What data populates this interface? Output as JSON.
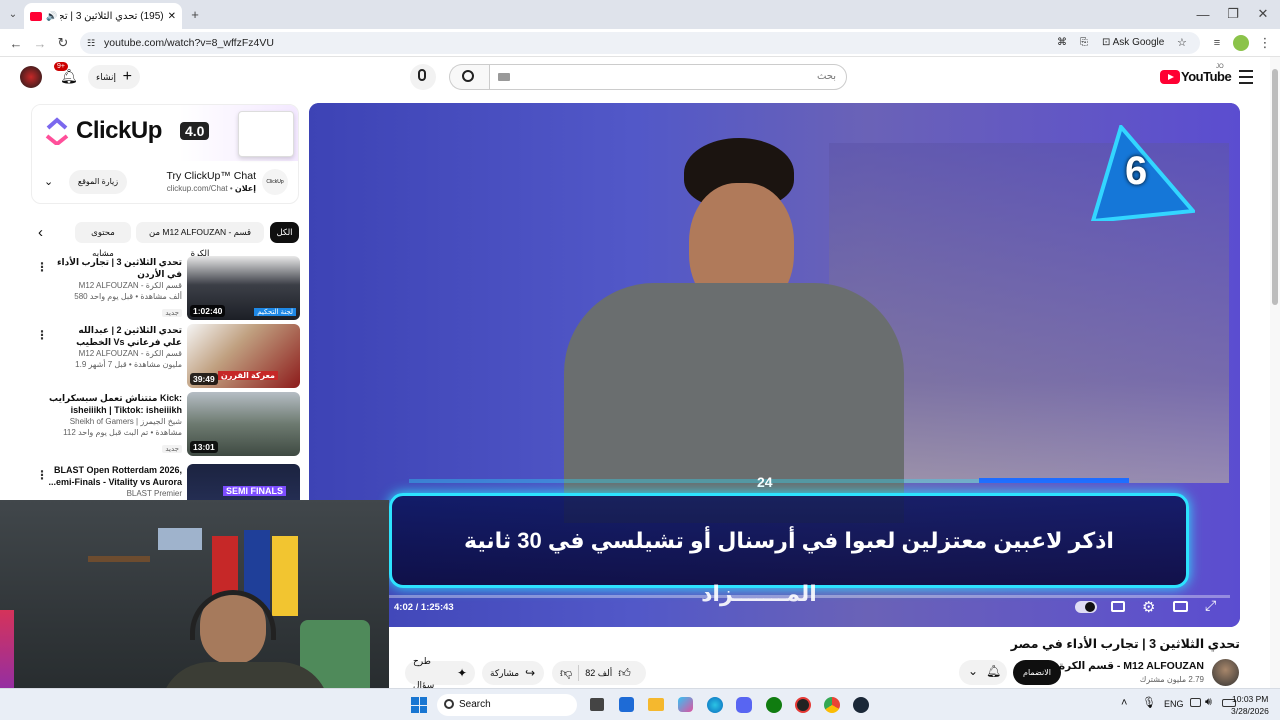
{
  "browser": {
    "tab_title": "(195) تحدي الثلاثين 3 | تجارب",
    "url": "youtube.com/watch?v=8_wffzFz4VU",
    "ask_google": "Ask Google"
  },
  "header": {
    "logo_text": "YouTube",
    "country": "JO",
    "search_placeholder": "بحث",
    "create_label": "إنشاء",
    "notif_count": "9+"
  },
  "ad": {
    "brand": "ClickUp",
    "version": "4.0",
    "title": "Try ClickUp™ Chat",
    "sponsor_label": "إعلان",
    "domain": "clickup.com/Chat",
    "visit_button": "زيارة الموقع",
    "logo_small": "ClickUp"
  },
  "chips": {
    "all": "الكل",
    "from_channel": "من M12 ALFOUZAN - قسم الكرة",
    "related": "محتوى مشابه"
  },
  "recommendations": [
    {
      "title": "تحدي الثلاثين 3 | تجارب الأداء في الأردن",
      "channel": "M12 ALFOUZAN - قسم الكرة",
      "stats": "580 ألف مشاهدة • قبل يوم واحد",
      "badge": "جديد",
      "duration": "1:02:40",
      "thumb_caption": "لجنة التحكيم"
    },
    {
      "title": "تحدي الثلاثين 2 | عبدالله الخطيب Vs علي فرعاني",
      "channel": "M12 ALFOUZAN - قسم الكرة",
      "stats": "1.9 مليون مشاهدة • قبل 7 أشهر",
      "badge": "",
      "duration": "39:49",
      "thumb_caption": "معركة القررن"
    },
    {
      "title": "متتناش تعمل سبسكرايب Kick: isheiiikh | Tiktok: isheiiikh",
      "channel": "Sheikh of Gamers | شيخ الجيمرز",
      "stats": "112 مشاهدة • تم البث قبل يوم واحد",
      "badge": "جديد",
      "duration": "13:01",
      "thumb_caption": ""
    },
    {
      "title": "BLAST Open Rotterdam 2026, ...emi-Finals - Vitality vs Aurora",
      "channel": "BLAST Premier",
      "stats": "",
      "badge": "",
      "duration": "",
      "thumb_caption": "SEMI FINALS"
    }
  ],
  "player": {
    "question": "اذكر لاعبين معتزلين لعبوا في أرسنال أو تشيلسي في 30 ثانية",
    "answer_partial": "المـــــــزاد",
    "timer": "24",
    "number_badge": "6",
    "time_display": "4:02 / 1:25:43",
    "progress_fraction": 0.047
  },
  "video": {
    "title": "تحدي الثلاثين 3 | تجارب الأداء في مصر",
    "channel": "M12 ALFOUZAN - قسم الكرة",
    "subscribers": "2.79 مليون مشترك",
    "join_label": "الانضمام",
    "likes": "82 ألف",
    "share_label": "مشاركة",
    "ask_label": "طرح سؤال"
  },
  "taskbar": {
    "search": "Search",
    "lang": "ENG",
    "time": "10:03 PM",
    "date": "3/28/2026"
  },
  "colors": {
    "youtube_red": "#ff0033",
    "player_blue": "#3d45b0",
    "caption_cyan": "#2de3ff"
  }
}
